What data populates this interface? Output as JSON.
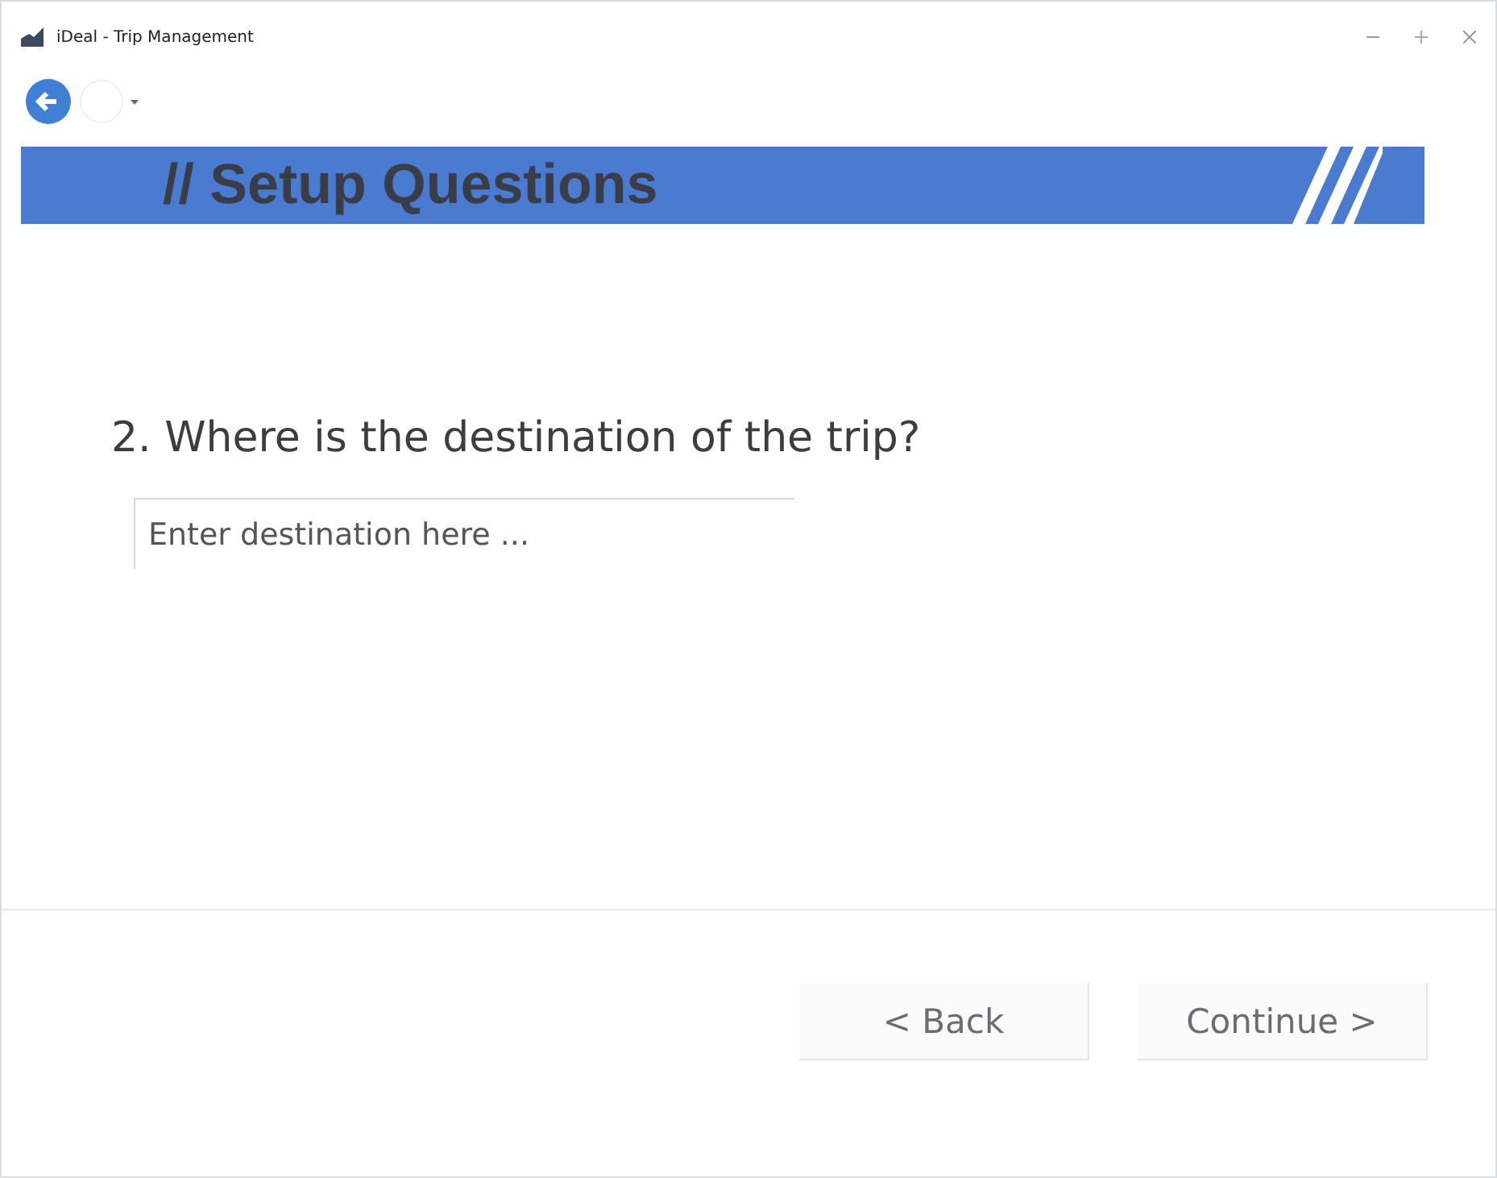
{
  "window": {
    "title": "iDeal - Trip Management"
  },
  "banner": {
    "title": "// Setup Questions"
  },
  "question": {
    "text": "2. Where is the destination of the trip?"
  },
  "destination_field": {
    "placeholder": "Enter destination here ..."
  },
  "buttons": [
    {
      "label": "< Back"
    },
    {
      "label": "Continue >"
    }
  ]
}
